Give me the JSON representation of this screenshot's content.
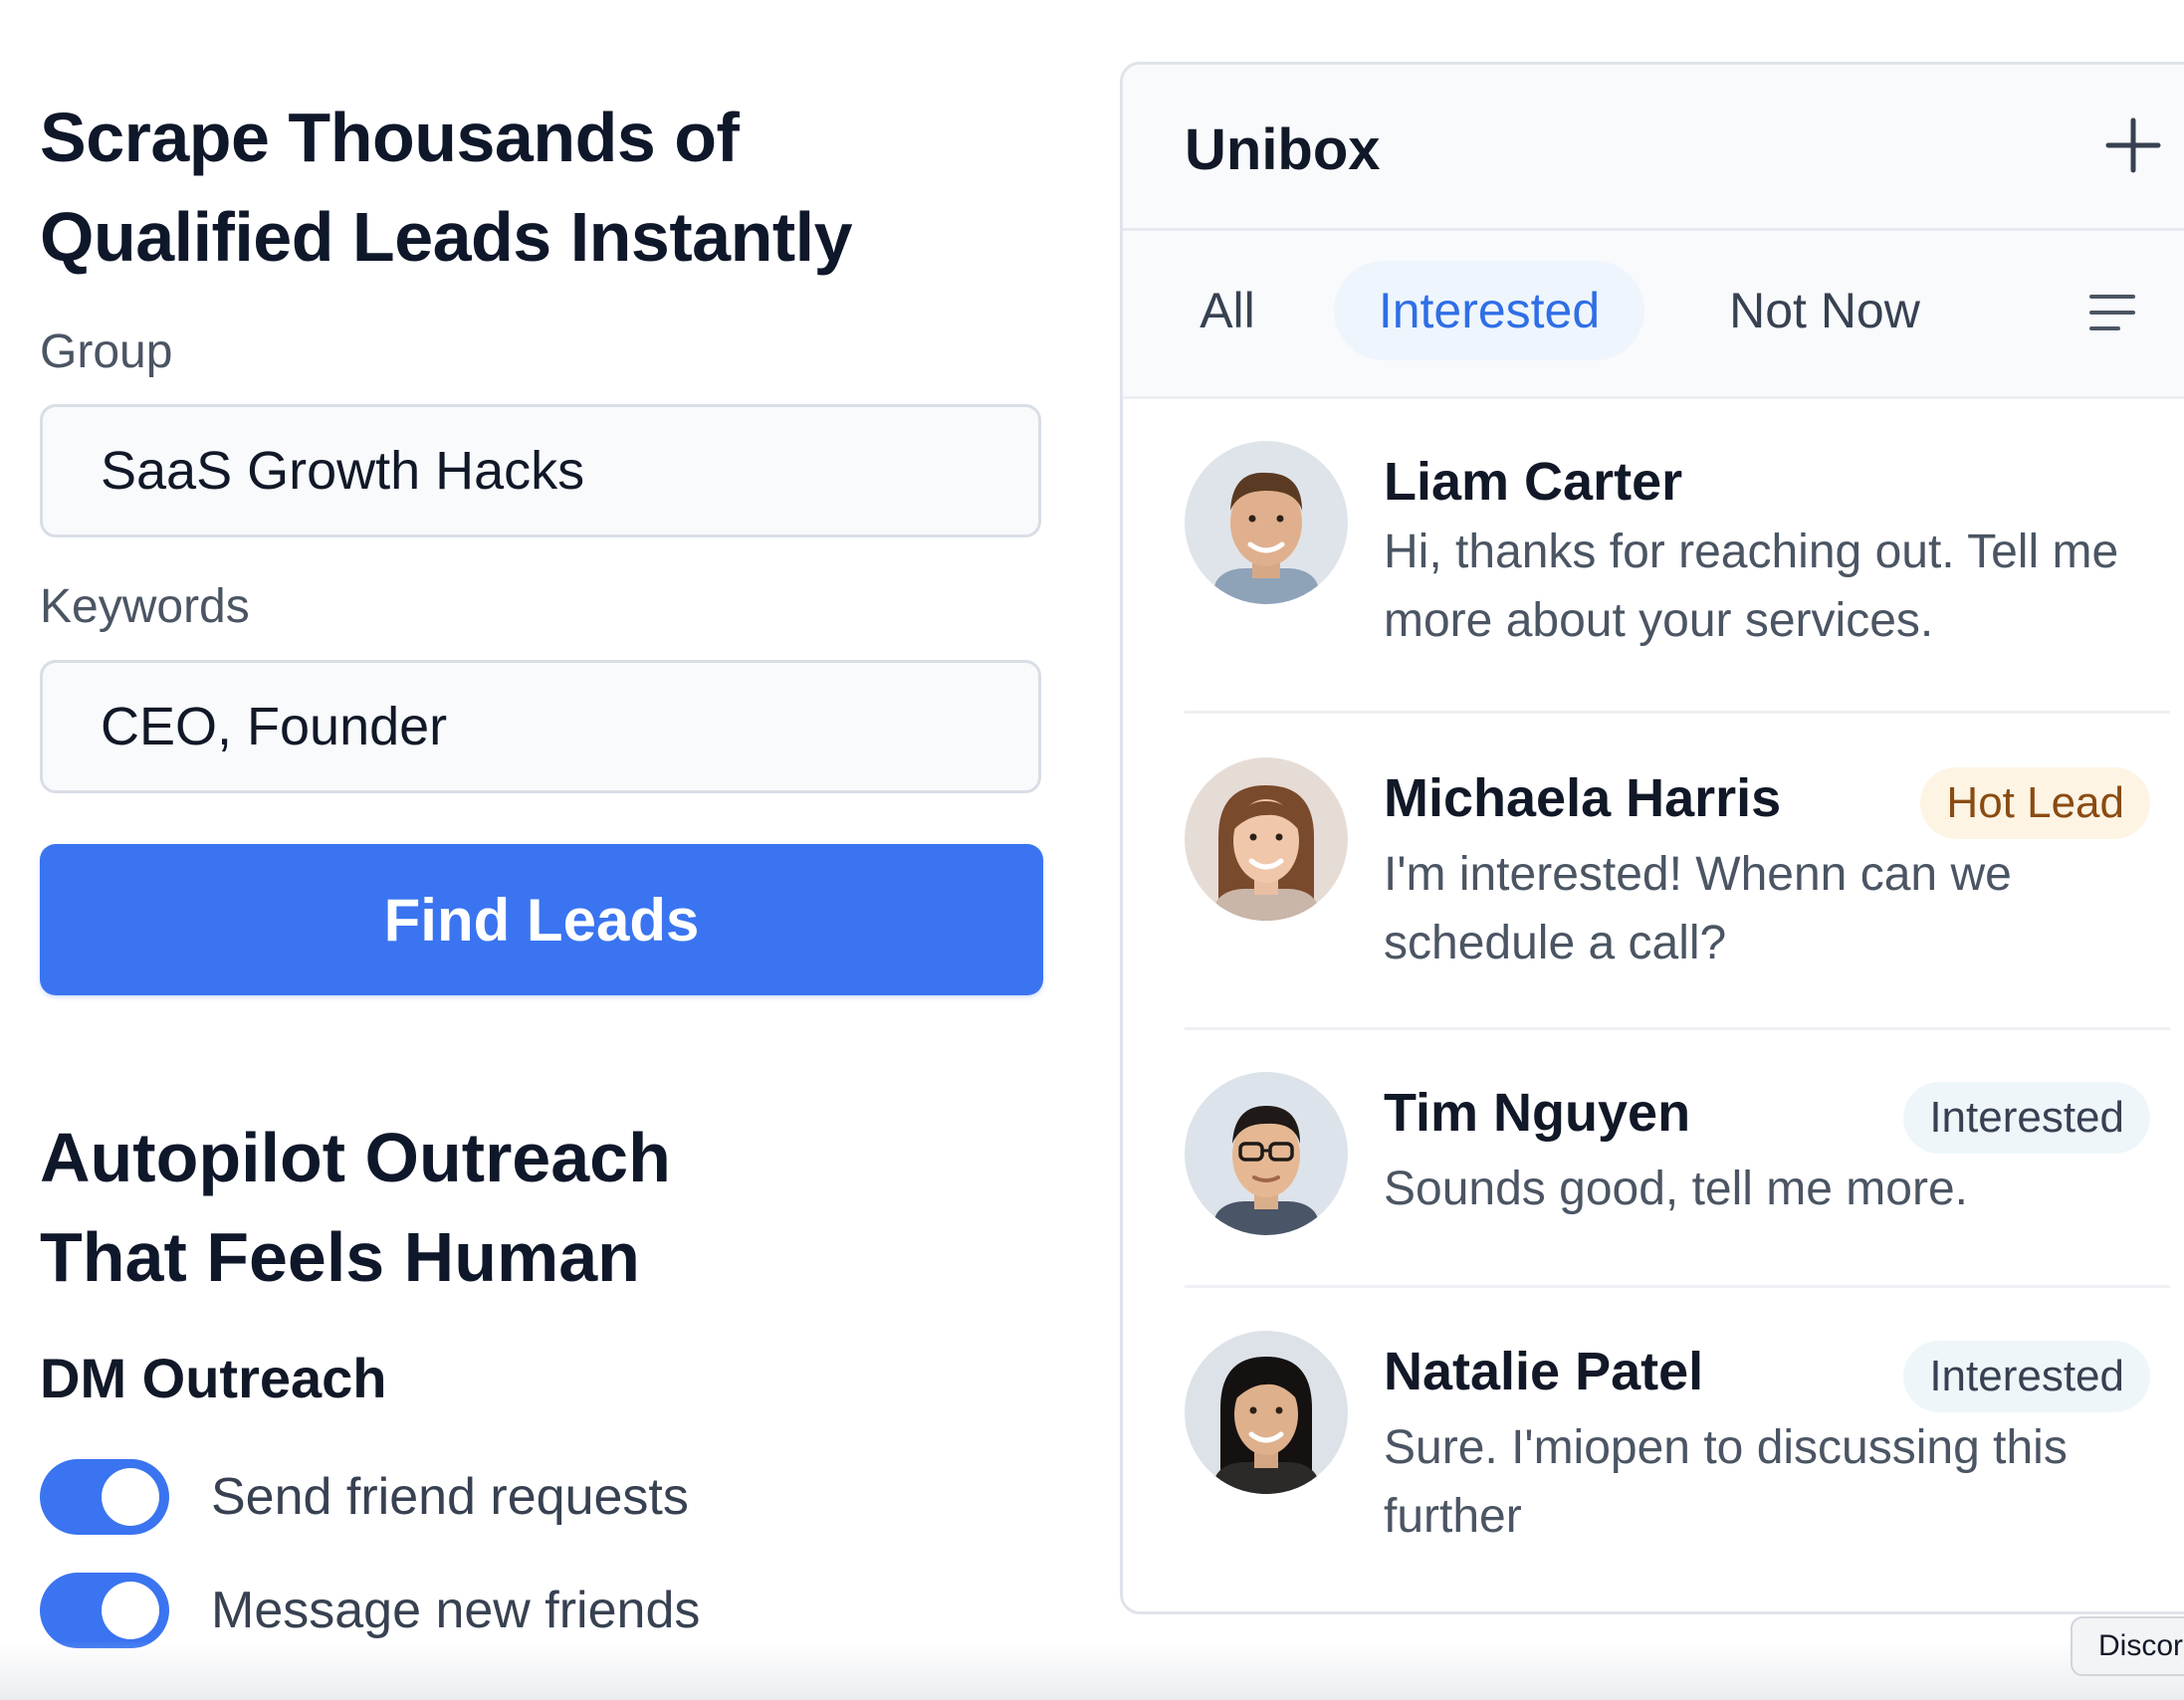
{
  "lead_finder": {
    "title_line1": "Scrape Thousands of",
    "title_line2": "Qualified Leads Instantly",
    "group_label": "Group",
    "group_value": "SaaS Growth Hacks",
    "keywords_label": "Keywords",
    "keywords_value": "CEO, Founder",
    "find_button": "Find Leads"
  },
  "outreach": {
    "title_line1": "Autopilot Outreach",
    "title_line2": "That Feels Human",
    "section_title": "DM Outreach",
    "toggles": [
      {
        "label": "Send friend requests",
        "on": true
      },
      {
        "label": "Message new friends",
        "on": true
      }
    ]
  },
  "unibox": {
    "title": "Unibox",
    "add_icon": "plus-icon",
    "filter_icon": "menu-lines-icon",
    "tabs": [
      {
        "label": "All",
        "active": false
      },
      {
        "label": "Interested",
        "active": true
      },
      {
        "label": "Not Now",
        "active": false
      }
    ],
    "conversations": [
      {
        "name": "Liam Carter",
        "message": "Hi, thanks for reaching out. Tell me more about your services.",
        "badge": ""
      },
      {
        "name": "Michaela Harris",
        "message": "I'm interested! Whenn can we schedule a call?",
        "badge": "Hot Lead"
      },
      {
        "name": "Tim Nguyen",
        "message": "Sounds good, tell me more.",
        "badge": "Interested"
      },
      {
        "name": "Natalie Patel",
        "message": "Sure. I'miopen to discussing this further",
        "badge": "Interested"
      }
    ]
  },
  "tooltip": {
    "text": "Discord"
  },
  "colors": {
    "accent": "#3a74f0",
    "hot_lead_bg": "#fdf4e4",
    "interested_bg": "#eef6fa"
  }
}
